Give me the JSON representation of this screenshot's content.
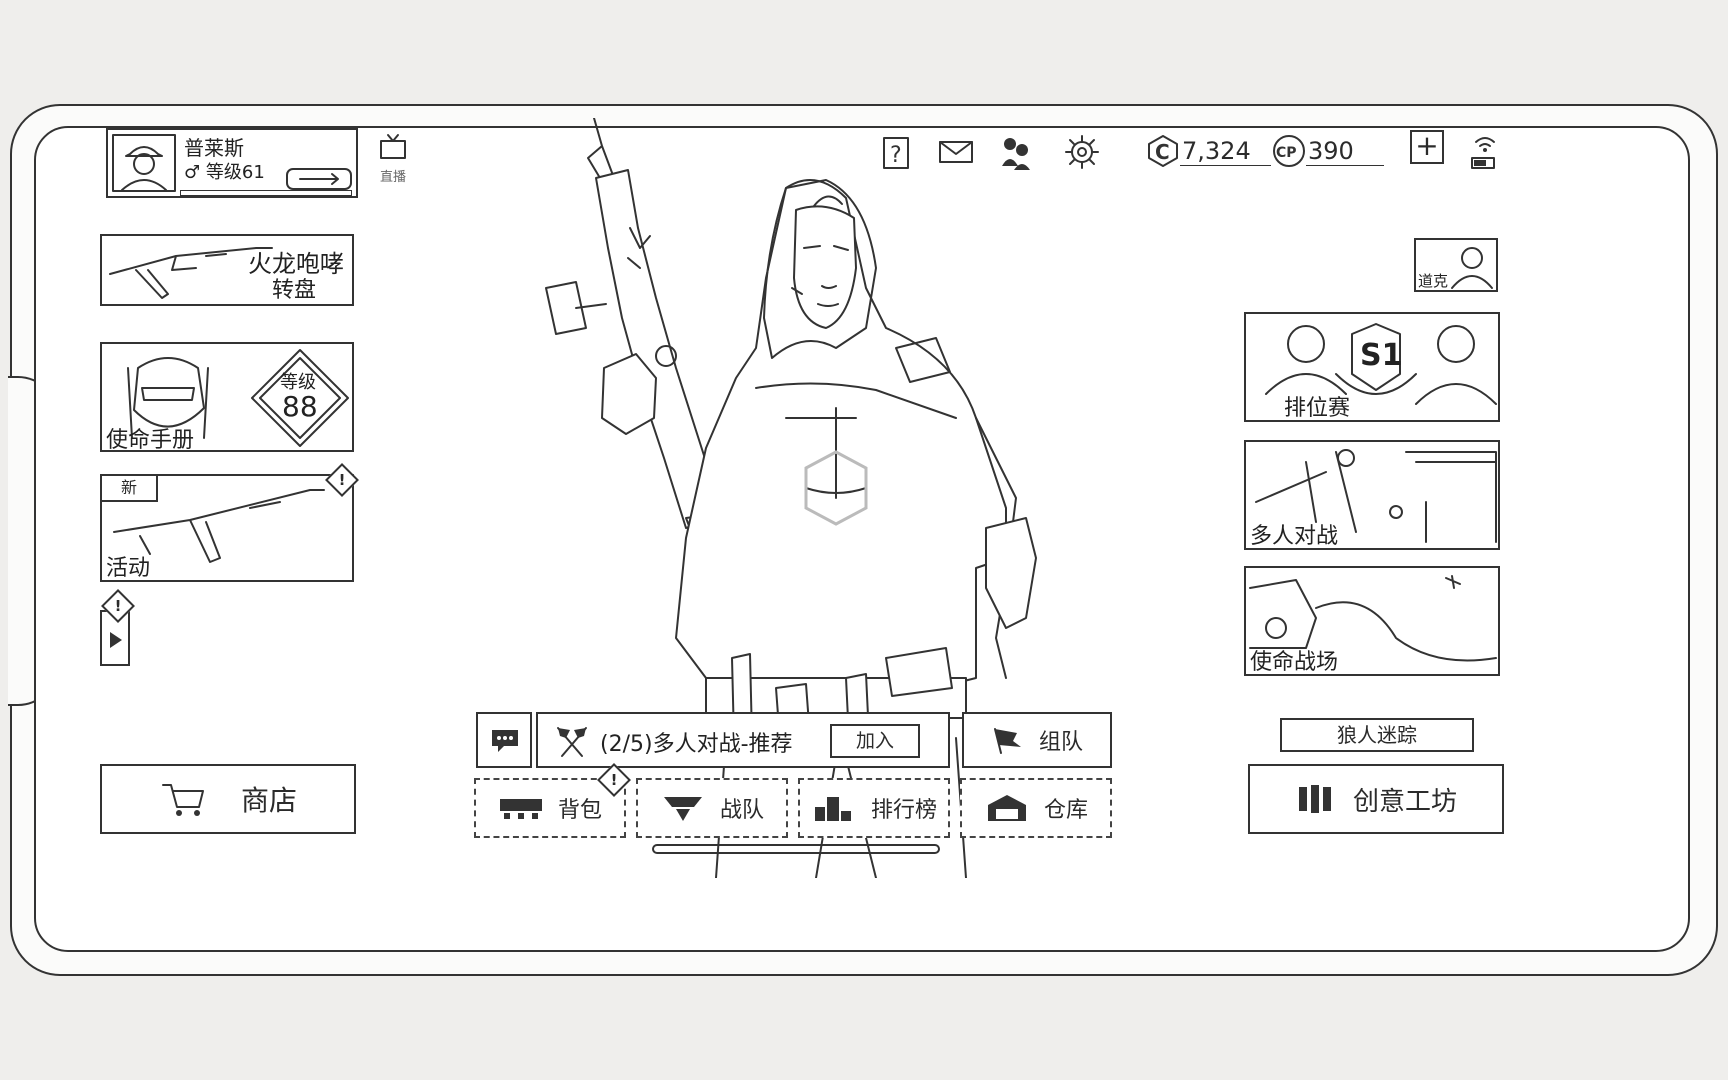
{
  "player": {
    "name": "普莱斯",
    "level_label": "等级61"
  },
  "broadcast": {
    "label": "直播"
  },
  "currency": {
    "c_value": "7,324",
    "cp_value": "390",
    "c_symbol": "C",
    "cp_symbol": "CP"
  },
  "left_panels": {
    "spin": {
      "line1": "火龙咆哮",
      "line2": "转盘"
    },
    "pass": {
      "label": "使命手册",
      "level_word": "等级",
      "level_value": "88"
    },
    "event": {
      "badge": "新",
      "label": "活动"
    }
  },
  "shop": {
    "label": "商店"
  },
  "right_panels": {
    "hero_name": "道克",
    "ranked": {
      "label": "排位赛",
      "season": "S1"
    },
    "multiplayer": {
      "label": "多人对战"
    },
    "battle_royale": {
      "label": "使命战场"
    }
  },
  "mode_select": {
    "label": "狼人迷踪"
  },
  "workshop": {
    "label": "创意工坊"
  },
  "party": {
    "text": "(2/5)多人对战-推荐",
    "join_label": "加入",
    "team_label": "组队"
  },
  "bottom_nav": [
    {
      "label": "背包",
      "icon": "backpack-icon"
    },
    {
      "label": "战队",
      "icon": "clan-icon"
    },
    {
      "label": "排行榜",
      "icon": "leaderboard-icon"
    },
    {
      "label": "仓库",
      "icon": "warehouse-icon"
    }
  ]
}
